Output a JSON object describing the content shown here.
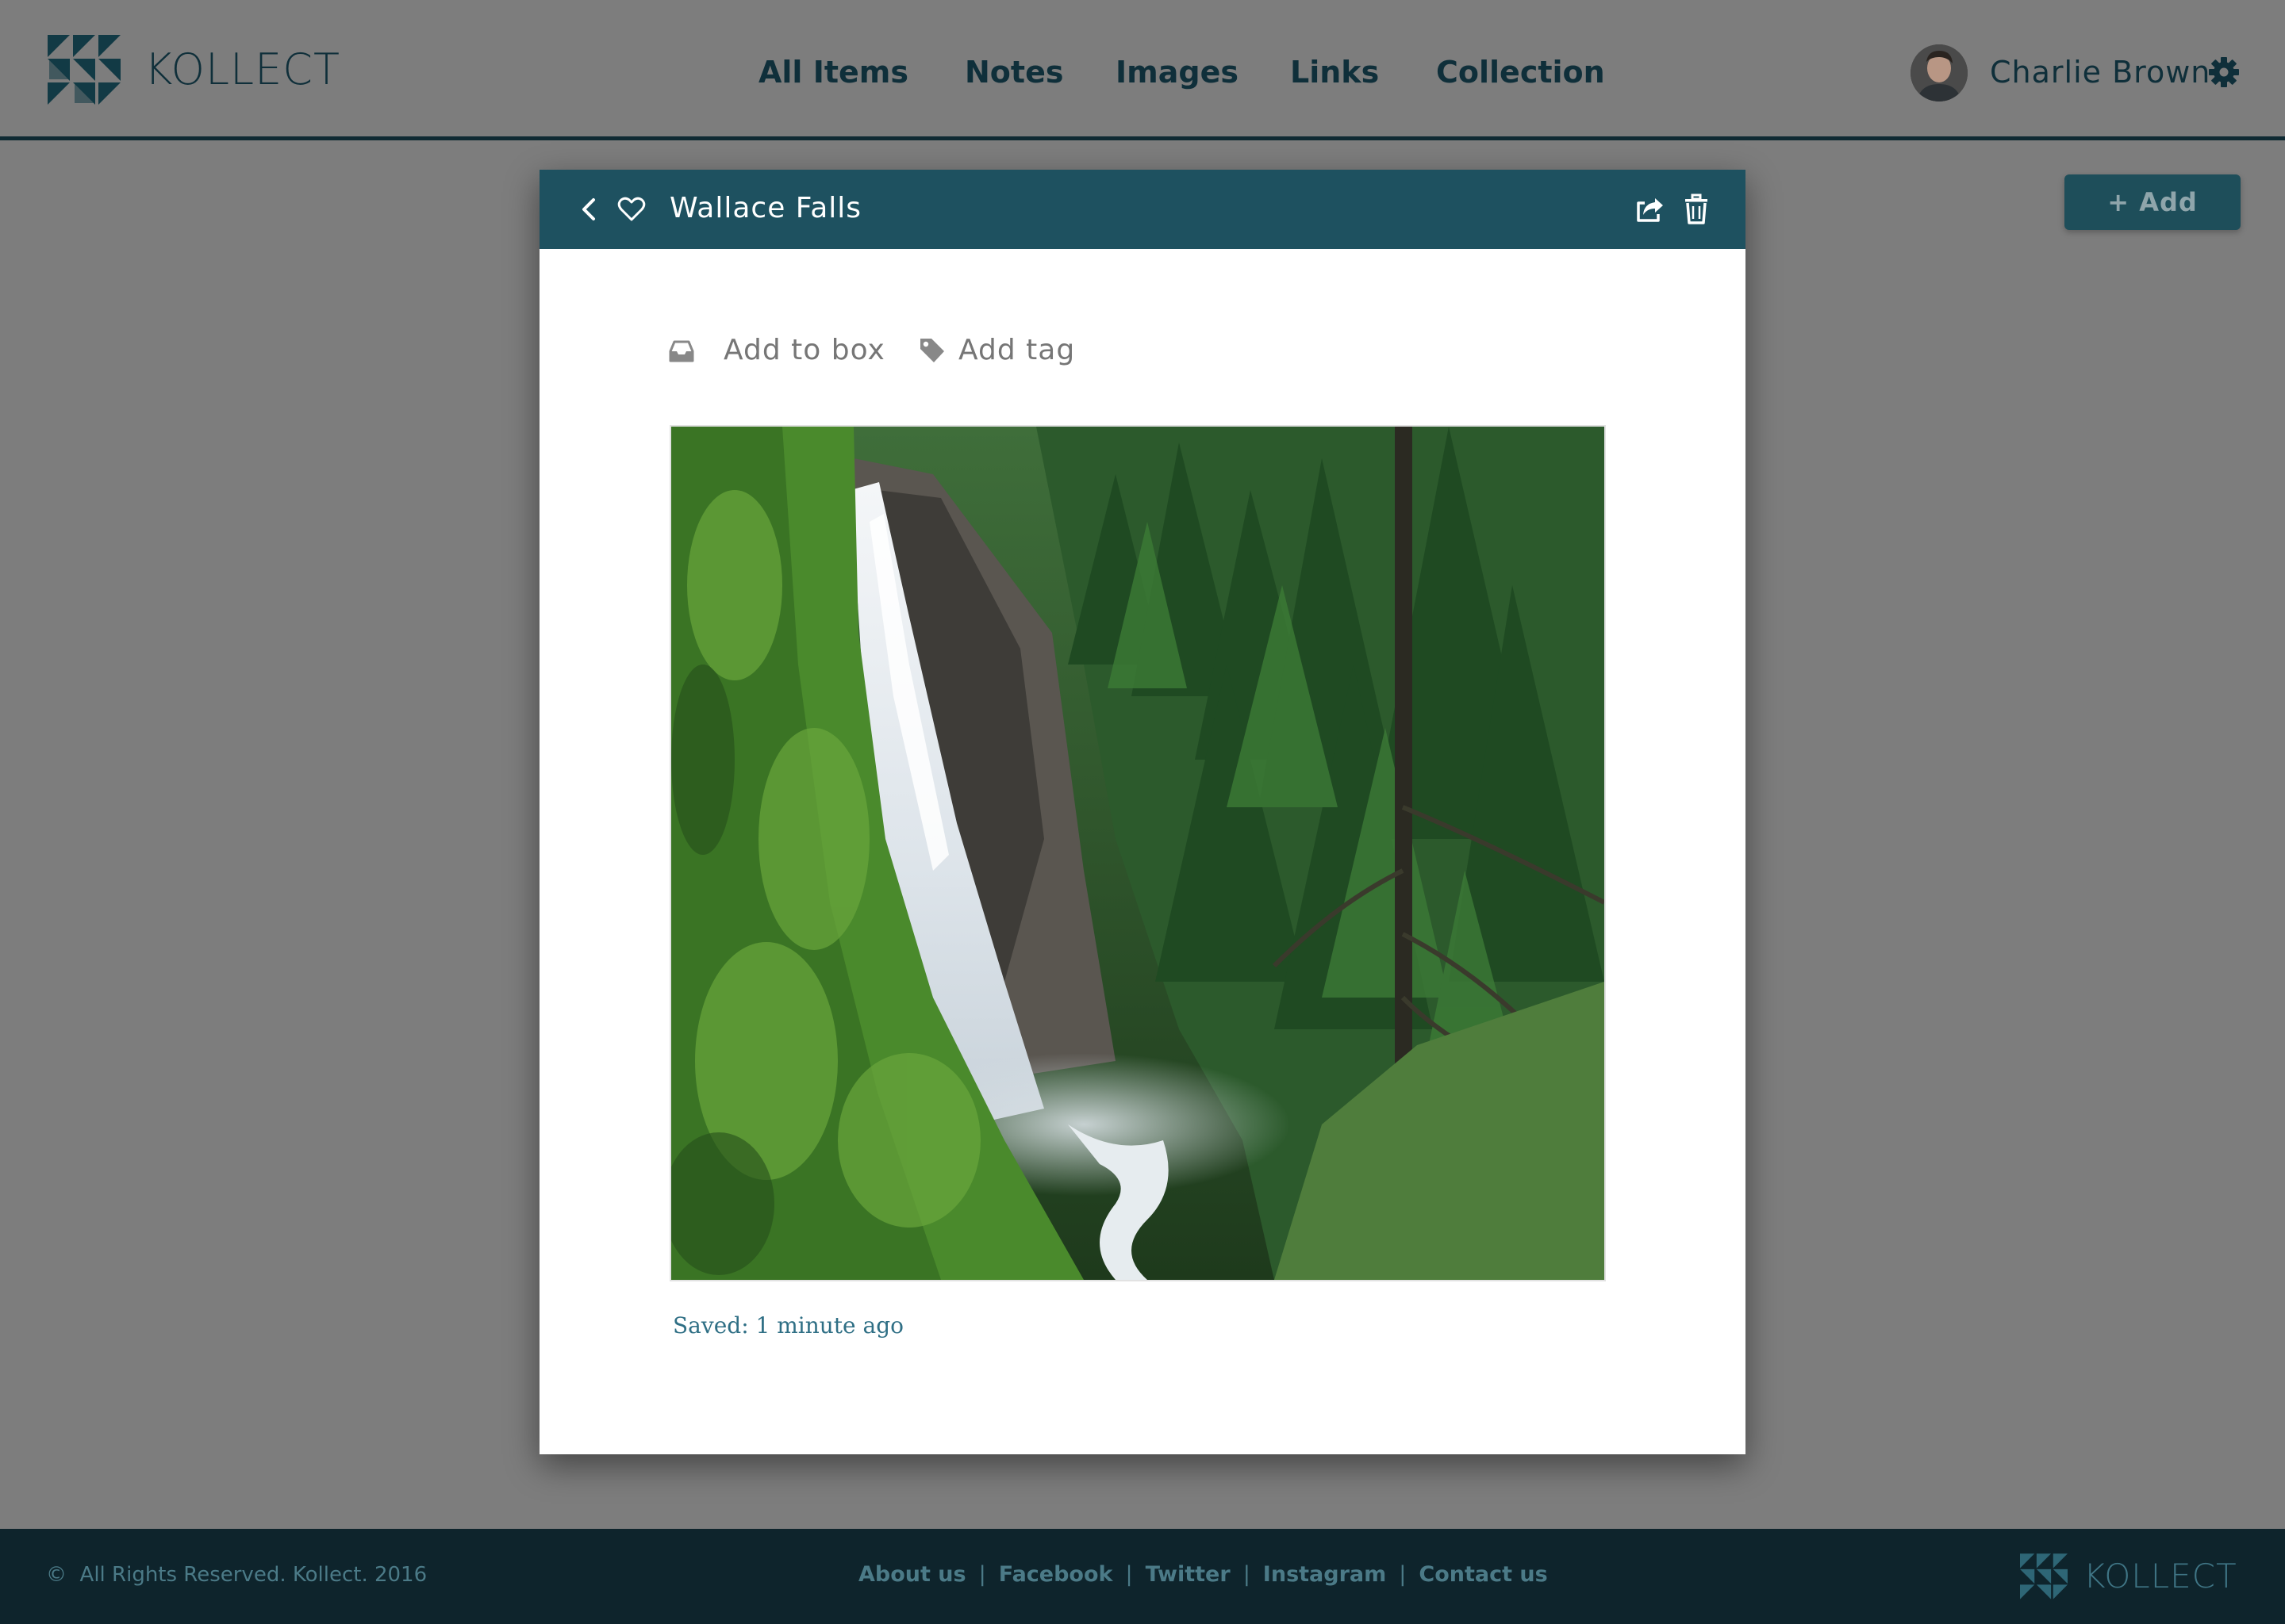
{
  "app": {
    "logo_text": "KOLLECT"
  },
  "nav": {
    "items": [
      {
        "label": "All Items"
      },
      {
        "label": "Notes"
      },
      {
        "label": "Images"
      },
      {
        "label": "Links"
      },
      {
        "label": "Collection"
      }
    ]
  },
  "user": {
    "name": "Charlie Brown"
  },
  "toolbar": {
    "add_label": "+ Add"
  },
  "modal": {
    "title": "Wallace Falls",
    "actions": [
      {
        "label": "Add to box",
        "icon": "inbox-icon"
      },
      {
        "label": "Add tag",
        "icon": "tag-icon"
      }
    ],
    "saved_text": "Saved: 1 minute ago"
  },
  "footer": {
    "copyright": "All Rights Reserved.  Kollect. 2016",
    "links": [
      "About us",
      "Facebook",
      "Twitter",
      "Instagram",
      "Contact us"
    ],
    "logo_text": "KOLLECT"
  },
  "colors": {
    "brand_dark": "#0f2f3a",
    "modal_bar": "#1e5160",
    "overlay_bg": "#7d7d7d",
    "footer_bg": "#0e242c",
    "link_teal": "#2f6f85"
  }
}
